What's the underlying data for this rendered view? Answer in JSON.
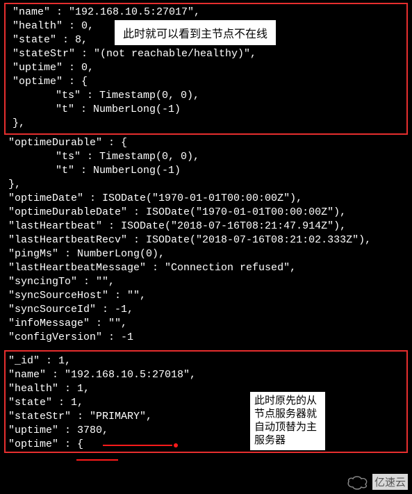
{
  "box1": {
    "l1": "\"name\" : \"192.168.10.5:27017\",",
    "l2": "\"health\" : 0,",
    "l3": "\"state\" : 8,",
    "l4": "\"stateStr\" : \"(not reachable/healthy)\",",
    "l5": "\"uptime\" : 0,",
    "l6": "\"optime\" : {",
    "l7": "\"ts\" : Timestamp(0, 0),",
    "l8": "\"t\" : NumberLong(-1)",
    "l9": "},"
  },
  "callout1_text": "此时就可以看到主节点不在线",
  "mid": {
    "l1": "\"optimeDurable\" : {",
    "l2": "\"ts\" : Timestamp(0, 0),",
    "l3": "\"t\" : NumberLong(-1)",
    "l4": "},",
    "l5": "\"optimeDate\" : ISODate(\"1970-01-01T00:00:00Z\"),",
    "l6": "\"optimeDurableDate\" : ISODate(\"1970-01-01T00:00:00Z\"),",
    "l7": "\"lastHeartbeat\" : ISODate(\"2018-07-16T08:21:47.914Z\"),",
    "l8": "\"lastHeartbeatRecv\" : ISODate(\"2018-07-16T08:21:02.333Z\"),",
    "l9": "\"pingMs\" : NumberLong(0),",
    "l10": "\"lastHeartbeatMessage\" : \"Connection refused\",",
    "l11": "\"syncingTo\" : \"\",",
    "l12": "\"syncSourceHost\" : \"\",",
    "l13": "\"syncSourceId\" : -1,",
    "l14": "\"infoMessage\" : \"\",",
    "l15": "\"configVersion\" : -1"
  },
  "box2": {
    "l1": "\"_id\" : 1,",
    "l2": "\"name\" : \"192.168.10.5:27018\",",
    "l3": "\"health\" : 1,",
    "l4": "\"state\" : 1,",
    "l5": "\"stateStr\" : \"PRIMARY\",",
    "l6": "\"uptime\" : 3780,",
    "l7": "\"optime\" : {"
  },
  "callout2_text": "此时原先的从节点服务器就自动顶替为主服务器",
  "watermark_text": "亿速云"
}
